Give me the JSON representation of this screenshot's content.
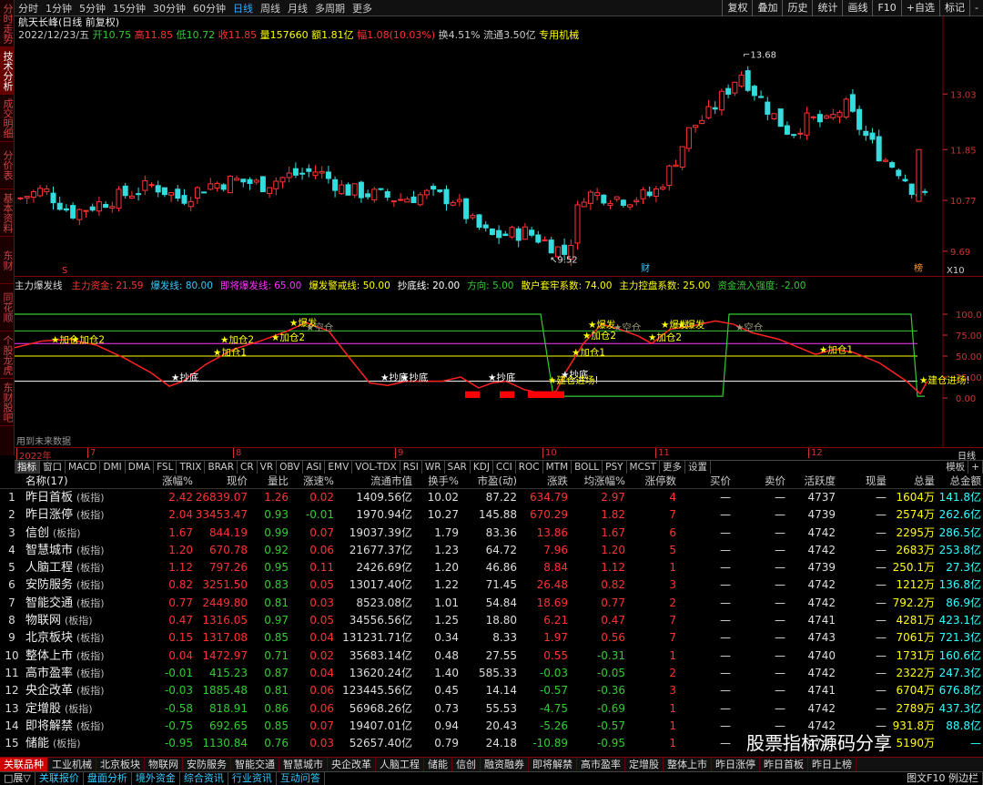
{
  "leftnav": [
    "分时走势",
    "技术分析",
    "成交明细",
    "分价表",
    "基本资料",
    "东财",
    "同花顺",
    "个股龙虎",
    "东财股吧"
  ],
  "periods": [
    "分时",
    "1分钟",
    "5分钟",
    "15分钟",
    "30分钟",
    "60分钟",
    "日线",
    "周线",
    "月线",
    "多周期",
    "更多"
  ],
  "tools": [
    "复权",
    "叠加",
    "历史",
    "统计",
    "画线",
    "F10",
    "+自选",
    "标记",
    "-"
  ],
  "stock": {
    "name": "航天长峰(日线 前复权)",
    "date": "2022/12/23/五",
    "open": "开10.75",
    "high": "高11.85",
    "low": "低10.72",
    "close": "收11.85",
    "vol": "量157660",
    "amt": "额1.81亿",
    "chg": "幅1.08(10.03%)",
    "turn": "换4.51%",
    "float": "流通3.50亿",
    "sector": "专用机械"
  },
  "kline": {
    "max_label": "13.68",
    "min_label": "9.52",
    "yticks": [
      "13.03",
      "11.85",
      "10.77",
      "9.69"
    ],
    "x10": "X10",
    "cai": "财",
    "bang": "榜",
    "s_mark": "S"
  },
  "indicator": {
    "name": "主力爆发线",
    "items": [
      {
        "t": "主力资金: 21.59",
        "c": "#f33"
      },
      {
        "t": "爆发线: 80.00",
        "c": "#3cf"
      },
      {
        "t": "即将爆发线: 65.00",
        "c": "#f3f"
      },
      {
        "t": "爆发警戒线: 50.00",
        "c": "#ff0"
      },
      {
        "t": "抄底线: 20.00",
        "c": "#fff"
      },
      {
        "t": "方向: 5.00",
        "c": "#3c3"
      },
      {
        "t": "散户套牢系数: 74.00",
        "c": "#ff0"
      },
      {
        "t": "主力控盘系数: 25.00",
        "c": "#ff0"
      },
      {
        "t": "资金流入强度: -2.00",
        "c": "#3c3"
      }
    ],
    "yticks": [
      "100.0",
      "75.00",
      "50.00",
      "25.00",
      "0.00"
    ],
    "no_data": "用到未来数据",
    "labels": {
      "jia": "加仓",
      "jia1": "加仓1",
      "jia2": "加仓2",
      "chaodi": "抄底",
      "baofa": "爆发",
      "kongcang": "空仓",
      "enter": "建仓进场!"
    }
  },
  "dates": [
    "2022年",
    "7",
    "8",
    "9",
    "10",
    "11",
    "12"
  ],
  "daxis_right": "日线",
  "indtabs": [
    "指标",
    "窗口",
    "MACD",
    "DMI",
    "DMA",
    "FSL",
    "TRIX",
    "BRAR",
    "CR",
    "VR",
    "OBV",
    "ASI",
    "EMV",
    "VOL-TDX",
    "RSI",
    "WR",
    "SAR",
    "KDJ",
    "CCI",
    "ROC",
    "MTM",
    "BOLL",
    "PSY",
    "MCST",
    "更多",
    "设置"
  ],
  "indtabs_right": [
    "模板",
    "+"
  ],
  "header": [
    "",
    "名称(17)",
    "涨幅%",
    "现价",
    "量比",
    "涨速%",
    "流通市值",
    "换手%",
    "市盈(动)",
    "涨跌",
    "均涨幅%",
    "涨停数",
    "买价",
    "卖价",
    "活跃度",
    "现量",
    "总量",
    "总金额"
  ],
  "rows": [
    [
      "1",
      "昨日首板",
      "2.42",
      "26839.07",
      "1.26",
      "0.02",
      "1409.56亿",
      "10.02",
      "87.22",
      "634.79",
      "2.97",
      "4",
      "—",
      "—",
      "4737",
      "—",
      "1604万",
      "141.8亿"
    ],
    [
      "2",
      "昨日涨停",
      "2.04",
      "33453.47",
      "0.93",
      "-0.01",
      "1970.94亿",
      "10.27",
      "145.88",
      "670.29",
      "1.82",
      "7",
      "—",
      "—",
      "4739",
      "—",
      "2574万",
      "262.6亿"
    ],
    [
      "3",
      "信创",
      "1.67",
      "844.19",
      "0.99",
      "0.07",
      "19037.39亿",
      "1.79",
      "83.36",
      "13.86",
      "1.67",
      "6",
      "—",
      "—",
      "4742",
      "—",
      "2295万",
      "286.5亿"
    ],
    [
      "4",
      "智慧城市",
      "1.20",
      "670.78",
      "0.92",
      "0.06",
      "21677.37亿",
      "1.23",
      "64.72",
      "7.96",
      "1.20",
      "5",
      "—",
      "—",
      "4742",
      "—",
      "2683万",
      "253.8亿"
    ],
    [
      "5",
      "人脑工程",
      "1.12",
      "797.26",
      "0.95",
      "0.11",
      "2426.69亿",
      "1.20",
      "46.86",
      "8.84",
      "1.12",
      "1",
      "—",
      "—",
      "4739",
      "—",
      "250.1万",
      "27.3亿"
    ],
    [
      "6",
      "安防服务",
      "0.82",
      "3251.50",
      "0.83",
      "0.05",
      "13017.40亿",
      "1.22",
      "71.45",
      "26.48",
      "0.82",
      "3",
      "—",
      "—",
      "4742",
      "—",
      "1212万",
      "136.8亿"
    ],
    [
      "7",
      "智能交通",
      "0.77",
      "2449.80",
      "0.81",
      "0.03",
      "8523.08亿",
      "1.01",
      "54.84",
      "18.69",
      "0.77",
      "2",
      "—",
      "—",
      "4742",
      "—",
      "792.2万",
      "86.9亿"
    ],
    [
      "8",
      "物联网",
      "0.47",
      "1316.05",
      "0.97",
      "0.05",
      "34556.56亿",
      "1.25",
      "18.80",
      "6.21",
      "0.47",
      "7",
      "—",
      "—",
      "4741",
      "—",
      "4281万",
      "423.1亿"
    ],
    [
      "9",
      "北京板块",
      "0.15",
      "1317.08",
      "0.85",
      "0.04",
      "131231.71亿",
      "0.34",
      "8.33",
      "1.97",
      "0.56",
      "7",
      "—",
      "—",
      "4743",
      "—",
      "7061万",
      "721.3亿"
    ],
    [
      "10",
      "整体上市",
      "0.04",
      "1472.97",
      "0.71",
      "0.02",
      "35683.14亿",
      "0.48",
      "27.55",
      "0.55",
      "-0.31",
      "1",
      "—",
      "—",
      "4740",
      "—",
      "1731万",
      "160.6亿"
    ],
    [
      "11",
      "高市盈率",
      "-0.01",
      "415.23",
      "0.87",
      "0.04",
      "13620.24亿",
      "1.40",
      "585.33",
      "-0.03",
      "-0.05",
      "2",
      "—",
      "—",
      "4742",
      "—",
      "2322万",
      "247.3亿"
    ],
    [
      "12",
      "央企改革",
      "-0.03",
      "1885.48",
      "0.81",
      "0.06",
      "123445.56亿",
      "0.45",
      "14.14",
      "-0.57",
      "-0.36",
      "3",
      "—",
      "—",
      "4741",
      "—",
      "6704万",
      "676.8亿"
    ],
    [
      "13",
      "定增股",
      "-0.58",
      "818.91",
      "0.86",
      "0.06",
      "56968.26亿",
      "0.73",
      "55.53",
      "-4.75",
      "-0.69",
      "1",
      "—",
      "—",
      "4742",
      "—",
      "2789万",
      "437.3亿"
    ],
    [
      "14",
      "即将解禁",
      "-0.75",
      "692.65",
      "0.85",
      "0.07",
      "19407.01亿",
      "0.94",
      "20.43",
      "-5.26",
      "-0.57",
      "1",
      "—",
      "—",
      "4742",
      "—",
      "931.8万",
      "88.8亿"
    ],
    [
      "15",
      "储能",
      "-0.95",
      "1130.84",
      "0.76",
      "0.03",
      "52657.40亿",
      "0.79",
      "24.18",
      "-10.89",
      "-0.95",
      "1",
      "—",
      "—",
      "4741",
      "—",
      "5190万",
      "—"
    ]
  ],
  "row_tag": "(板指)",
  "sectors": [
    "关联品种",
    "工业机械",
    "北京板块",
    "物联网",
    "安防服务",
    "智能交通",
    "智慧城市",
    "央企改革",
    "人脑工程",
    "储能",
    "信创",
    "融资融券",
    "即将解禁",
    "高市盈率",
    "定增股",
    "整体上市",
    "昨日涨停",
    "昨日首板",
    "昨日上榜"
  ],
  "bottom": [
    "□展▽",
    "关联报价",
    "盘面分析",
    "境外资金",
    "综合资讯",
    "行业资讯",
    "互动问答"
  ],
  "bottom_right": "图文F10  例边栏",
  "watermark": "股票指标源码分享",
  "colors": {
    "up": "#ff3333",
    "down": "#33cccc",
    "accent": "#3399ff"
  }
}
